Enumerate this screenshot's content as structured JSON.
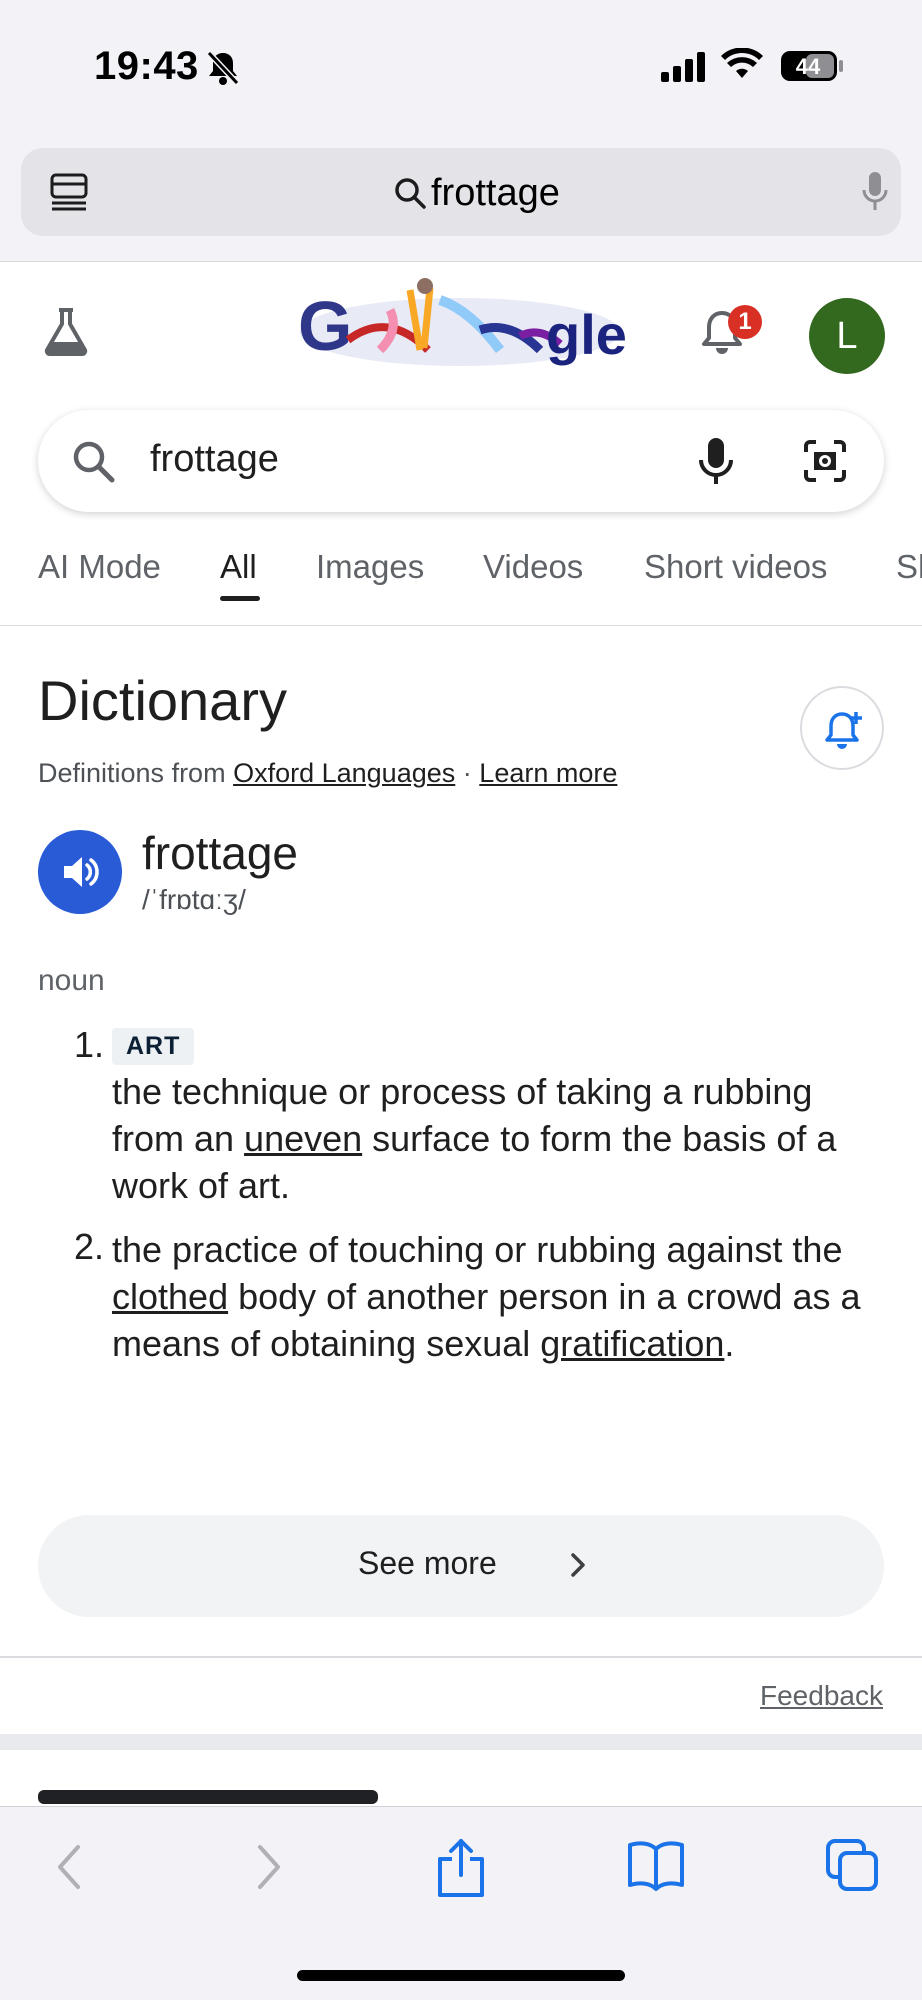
{
  "status": {
    "time": "19:43",
    "battery": "44"
  },
  "address_bar": {
    "query": "frottage"
  },
  "google": {
    "notification_count": "1",
    "avatar_letter": "L"
  },
  "search": {
    "query": "frottage"
  },
  "tabs": [
    {
      "label": "AI Mode"
    },
    {
      "label": "All"
    },
    {
      "label": "Images"
    },
    {
      "label": "Videos"
    },
    {
      "label": "Short videos"
    },
    {
      "label": "Sh"
    }
  ],
  "dictionary": {
    "title": "Dictionary",
    "source_prefix": "Definitions from",
    "source_link": "Oxford Languages",
    "separator": "·",
    "learn_more": "Learn more",
    "word": "frottage",
    "phonetic": "/ˈfrɒtɑːʒ/",
    "part_of_speech": "noun",
    "definitions": [
      {
        "number": "1.",
        "tag": "ART",
        "text_before": "the technique or process of taking a rubbing from an ",
        "link": "uneven",
        "text_after": " surface to form the basis of a work of art."
      },
      {
        "number": "2.",
        "text_a": "the practice of touching or rubbing against the ",
        "link_a": "clothed",
        "text_b": " body of another person in a crowd as a means of obtaining sexual ",
        "link_b": "gratification",
        "text_c": "."
      }
    ],
    "see_more": "See more",
    "feedback": "Feedback"
  }
}
